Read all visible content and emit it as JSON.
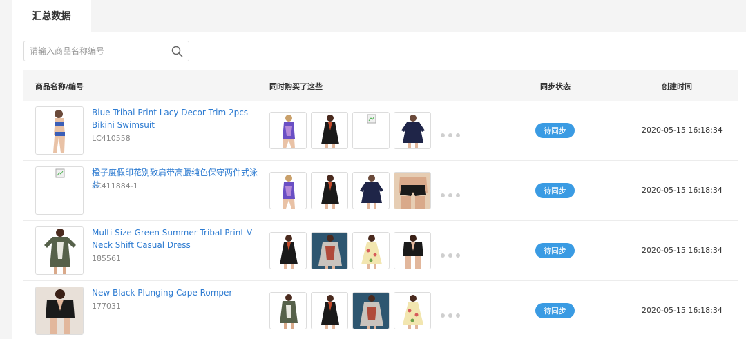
{
  "tabs": {
    "active": "汇总数据"
  },
  "search": {
    "placeholder": "请输入商品名称编号"
  },
  "table": {
    "headers": {
      "product": "商品名称/编号",
      "also_bought": "同时购买了这些",
      "sync_status": "同步状态",
      "created_time": "创建时间"
    },
    "rows": [
      {
        "title": "Blue Tribal Print Lacy Decor Trim 2pcs Bikini Swimsuit",
        "code": "LC410558",
        "status": "待同步",
        "time": "2020-05-15 16:18:34",
        "product_image": "bikini-model",
        "thumbs": [
          "tribal-swimsuit",
          "black-swimdress",
          "broken-image",
          "navy-dress"
        ]
      },
      {
        "title": "橙子度假印花别致肩带高腰纯色保守两件式泳装",
        "code": "LC411884-1",
        "status": "待同步",
        "time": "2020-05-15 16:18:34",
        "product_image": "broken-image",
        "thumbs": [
          "tribal-swimsuit",
          "black-swimdress",
          "navy-dress",
          "black-shorts"
        ]
      },
      {
        "title": "Multi Size Green Summer Tribal Print V-Neck Shift Casual Dress",
        "code": "185561",
        "status": "待同步",
        "time": "2020-05-15 16:18:34",
        "product_image": "green-dress",
        "thumbs": [
          "black-swimdress",
          "printed-coverup",
          "floral-dress",
          "black-romper"
        ]
      },
      {
        "title": "New Black Plunging Cape Romper",
        "code": "177031",
        "status": "待同步",
        "time": "2020-05-15 16:18:34",
        "product_image": "black-romper",
        "thumbs": [
          "green-dress",
          "black-swimdress",
          "printed-coverup",
          "floral-dress"
        ]
      }
    ]
  },
  "colors": {
    "link": "#2d7bd1",
    "status_bg": "#3a9be3",
    "header_bg": "#f5f5f5"
  }
}
